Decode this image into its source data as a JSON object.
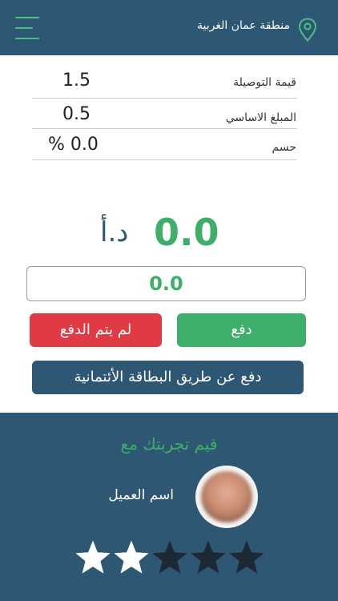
{
  "header": {
    "region": "منطقة عمان الغربية",
    "menu_icon": "hamburger-menu-icon",
    "location_icon": "map-pin-icon"
  },
  "summary": {
    "delivery_label": "قيمة التوصيلة",
    "delivery_value": "1.5",
    "base_label": "المبلغ الاساسي",
    "base_value": "0.5",
    "discount_label": "حسم",
    "discount_value": "% 0.0"
  },
  "total": {
    "value": "0.0",
    "currency": "د.أ"
  },
  "payment": {
    "amount_value": "0.0",
    "pay_label": "دفع",
    "not_paid_label": "لم يتم الدفع",
    "card_label": "دفع عن طريق البطاقة الأئتمانية"
  },
  "rating": {
    "title": "قيم تجربتك مع",
    "customer_name": "اسم العميل",
    "stars_total": 5,
    "stars_filled": 2
  },
  "colors": {
    "primary": "#2e5774",
    "accent": "#3eaf6b",
    "danger": "#e03b44",
    "star_on": "#ffffff",
    "star_off": "#1d2a36"
  }
}
